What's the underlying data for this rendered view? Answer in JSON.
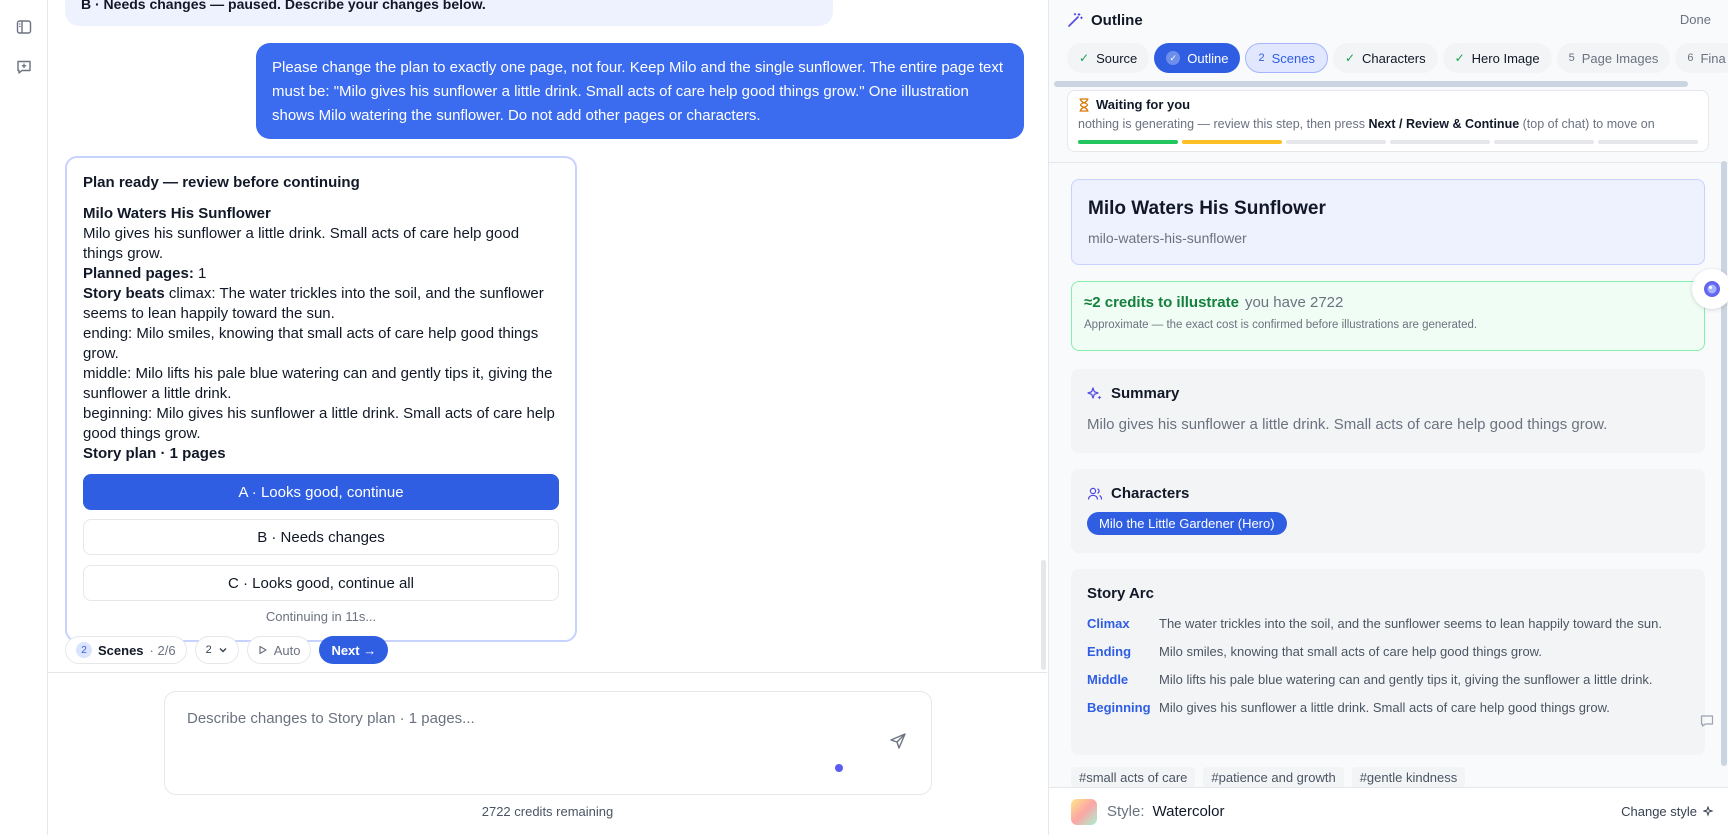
{
  "chat": {
    "prev_message": "B · Needs changes — paused. Describe your changes below.",
    "user_message": "Please change the plan to exactly one page, not four. Keep Milo and the single sunflower. The entire page text must be: \"Milo gives his sunflower a little drink. Small acts of care help good things grow.\" One illustration shows Milo watering the sunflower. Do not add other pages or characters.",
    "plan": {
      "header": "Plan ready — review before continuing",
      "title": "Milo Waters His Sunflower",
      "summary": "Milo gives his sunflower a little drink. Small acts of care help good things grow.",
      "planned_pages_label": "Planned pages:",
      "planned_pages_value": "1",
      "beats_label": "Story beats",
      "climax": "climax: The water trickles into the soil, and the sunflower seems to lean happily toward the sun.",
      "ending": "ending: Milo smiles, knowing that small acts of care help good things grow.",
      "middle": "middle: Milo lifts his pale blue watering can and gently tips it, giving the sunflower a little drink.",
      "beginning": "beginning: Milo gives his sunflower a little drink. Small acts of care help good things grow.",
      "plan_footer": "Story plan · 1 pages",
      "option_a": "A · Looks good, continue",
      "option_b": "B · Needs changes",
      "option_c": "C · Looks good, continue all",
      "continuing": "Continuing in 11s..."
    },
    "status": {
      "scenes_num": "2",
      "scenes_label": "Scenes",
      "scenes_progress": "· 2/6",
      "select_value": "2",
      "auto_label": "Auto",
      "next_label": "Next →"
    },
    "composer": {
      "placeholder": "Describe changes to Story plan · 1 pages..."
    },
    "credits_remaining": "2722 credits remaining"
  },
  "panel": {
    "title": "Outline",
    "done": "Done",
    "steps": [
      {
        "label": "Source",
        "mark": "✓"
      },
      {
        "label": "Outline",
        "mark": "✓"
      },
      {
        "label": "Scenes",
        "mark": "2"
      },
      {
        "label": "Characters",
        "mark": "✓"
      },
      {
        "label": "Hero Image",
        "mark": "✓"
      },
      {
        "label": "Page Images",
        "mark": "5"
      },
      {
        "label": "Fina",
        "mark": "6"
      }
    ],
    "waiting": {
      "title": "Waiting for you",
      "text_a": "nothing is generating — review this step, then press ",
      "text_b": "Next / Review & Continue",
      "text_c": " (top of chat) to move on"
    },
    "story_title": "Milo Waters His Sunflower",
    "story_slug": "milo-waters-his-sunflower",
    "credits": {
      "main": "≈2 credits to illustrate",
      "have": "you have 2722",
      "note": "Approximate — the exact cost is confirmed before illustrations are generated."
    },
    "summary": {
      "heading": "Summary",
      "text": "Milo gives his sunflower a little drink. Small acts of care help good things grow."
    },
    "characters": {
      "heading": "Characters",
      "chip": "Milo the Little Gardener (Hero)"
    },
    "arc": {
      "heading": "Story Arc",
      "rows": [
        {
          "label": "Climax",
          "text": "The water trickles into the soil, and the sunflower seems to lean happily toward the sun."
        },
        {
          "label": "Ending",
          "text": "Milo smiles, knowing that small acts of care help good things grow."
        },
        {
          "label": "Middle",
          "text": "Milo lifts his pale blue watering can and gently tips it, giving the sunflower a little drink."
        },
        {
          "label": "Beginning",
          "text": "Milo gives his sunflower a little drink. Small acts of care help good things grow."
        }
      ]
    },
    "tags": [
      "#small acts of care",
      "#patience and growth",
      "#gentle kindness"
    ],
    "style": {
      "label": "Style:",
      "value": "Watercolor",
      "change": "Change style"
    }
  },
  "colors": {
    "accent": "#2f5ee3",
    "user_bubble": "#3b6cf0",
    "success": "#15803d",
    "progress_done": "#22c55e",
    "progress_current": "#fbbf24"
  }
}
